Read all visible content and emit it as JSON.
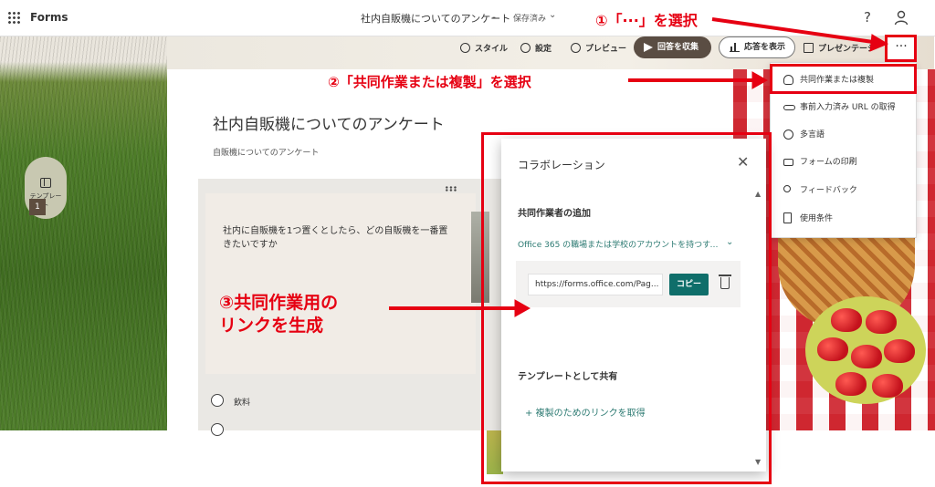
{
  "header": {
    "app_name": "Forms",
    "doc_title": "社内自販機についてのアンケート",
    "doc_separator": "-",
    "doc_status": "保存済み",
    "chevron_icon": "chevron-down-icon",
    "help_label": "?"
  },
  "toolbar": {
    "style_label": "スタイル",
    "settings_label": "設定",
    "preview_label": "プレビュー",
    "collect_label": "回答を収集",
    "responses_label": "応答を表示",
    "present_label": "プレゼンテーション",
    "more_label": "···"
  },
  "sidebar": {
    "template_label": "テンプレート"
  },
  "form": {
    "title": "社内自販機についてのアンケート",
    "subtitle": "自販機についてのアンケート",
    "question_number": "1",
    "question_text": "社内に自販機を1つ置くとしたら、どの自販機を一番置きたいですか",
    "options": [
      "飲料"
    ]
  },
  "menu": {
    "items": [
      {
        "label": "共同作業または複製",
        "icon": "collaborate-icon"
      },
      {
        "label": "事前入力済み URL の取得",
        "icon": "link-icon"
      },
      {
        "label": "多言語",
        "icon": "globe-icon"
      },
      {
        "label": "フォームの印刷",
        "icon": "print-icon"
      },
      {
        "label": "フィードバック",
        "icon": "feedback-icon"
      },
      {
        "label": "使用条件",
        "icon": "document-icon"
      }
    ]
  },
  "panel": {
    "title": "コラボレーション",
    "coauthor_heading": "共同作業者の追加",
    "permission_text": "Office 365 の職場または学校のアカウントを持つすべ...",
    "link_value": "https://forms.office.com/Pag...",
    "copy_label": "コピー",
    "template_heading": "テンプレートとして共有",
    "duplicate_link_label": "複製のためのリンクを取得",
    "plus_label": "+"
  },
  "annotations": {
    "step1": "①「···」を選択",
    "step2": "②「共同作業または複製」を選択",
    "step3_line1": "③共同作業用の",
    "step3_line2": "リンクを生成",
    "color": "#e60012"
  },
  "colors": {
    "accent_teal": "#0f6e6a",
    "collect_button": "#5a4d43",
    "annotation_red": "#e60012"
  }
}
